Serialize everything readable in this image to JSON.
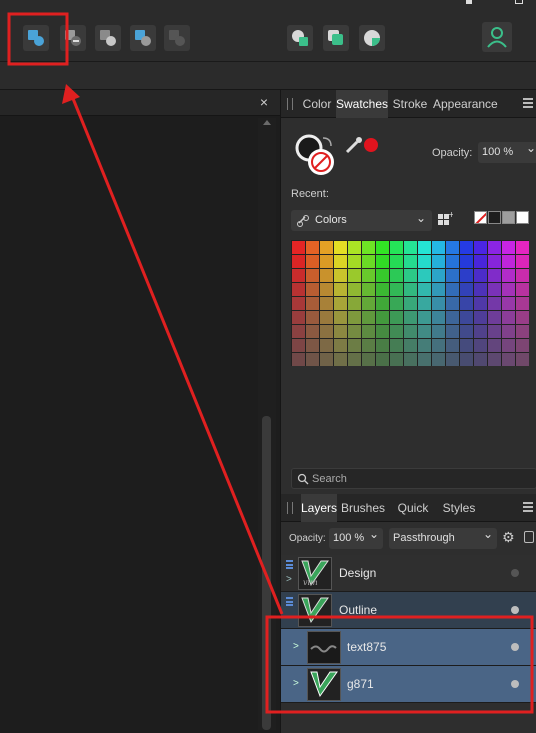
{
  "toolbar": {
    "buttons": [
      {
        "name": "add-boolean-icon"
      },
      {
        "name": "subtract-boolean-icon"
      },
      {
        "name": "intersect-boolean-icon"
      },
      {
        "name": "xor-boolean-icon"
      },
      {
        "name": "divide-boolean-icon"
      },
      {
        "name": "insert-behind-icon"
      },
      {
        "name": "insert-front-icon"
      },
      {
        "name": "insert-inside-icon"
      },
      {
        "name": "user-account-icon"
      }
    ]
  },
  "canvas": {
    "close_label": "×"
  },
  "color_panel": {
    "tabs": [
      "Color",
      "Swatches",
      "Stroke",
      "Appearance"
    ],
    "active_tab": "Swatches",
    "opacity_label": "Opacity:",
    "opacity_value": "100 %",
    "recent_label": "Recent:",
    "palette_name": "Colors",
    "recent_swatches": [
      "none",
      "#1e1e1e",
      "#9e9e9e",
      "#ffffff"
    ],
    "search_placeholder": "Search"
  },
  "layers_panel": {
    "tabs": [
      "Layers",
      "Brushes",
      "Quick FX",
      "Styles"
    ],
    "active_tab": "Layers",
    "opacity_label": "Opacity:",
    "opacity_value": "100 %",
    "blend_mode": "Passthrough",
    "layers": [
      {
        "name": "Design",
        "state": "normal"
      },
      {
        "name": "Outline",
        "state": "parent-selected"
      },
      {
        "name": "text875",
        "state": "selected"
      },
      {
        "name": "g871",
        "state": "selected"
      }
    ]
  },
  "colors": {
    "annotation": "#e02020",
    "selection": "#4a6586",
    "accent_green": "#3bbf8a"
  }
}
